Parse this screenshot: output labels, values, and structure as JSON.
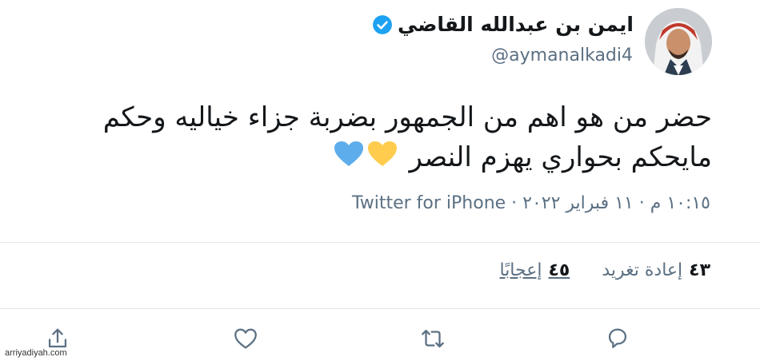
{
  "author": {
    "name": "ايمن بن عبدالله القاضي",
    "handle": "@aymanalkadi4",
    "verified": true
  },
  "tweet": {
    "text": "حضر من هو اهم من الجمهور بضربة جزاء خياليه وحكم مايحكم بحواري يهزم النصر",
    "emojis": [
      "yellow-heart-icon",
      "blue-heart-icon"
    ],
    "meta": "١٠:١٥ م · ١١ فبراير ٢٠٢٢ · Twitter for iPhone"
  },
  "stats": {
    "retweets_count": "٤٣",
    "retweets_label": "إعادة تغريد",
    "likes_count": "٤٥",
    "likes_label": "إعجابًا"
  },
  "actions": [
    "reply-icon",
    "retweet-icon",
    "like-icon",
    "share-icon"
  ],
  "watermark": "arriyadiyah.com",
  "colors": {
    "verified": "#1da1f2",
    "yellow_heart": "#ffcc4d",
    "blue_heart": "#5dadec",
    "secondary_text": "#5b7083",
    "icon": "#5b7083"
  }
}
